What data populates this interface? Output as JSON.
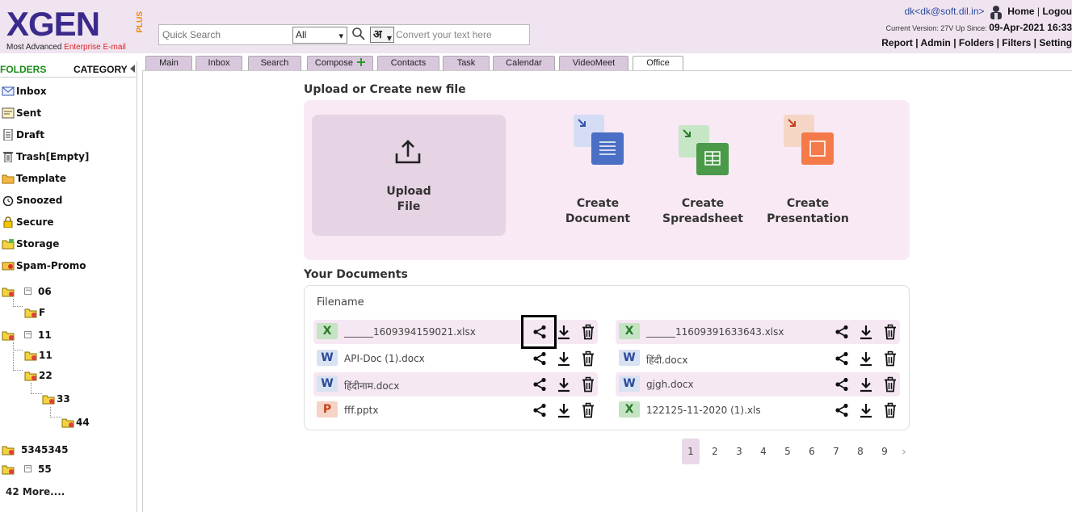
{
  "header": {
    "logo_text": "XGEN",
    "logo_plus": "PLUS",
    "tagline_prefix": "Most Advanced ",
    "tagline_highlight": "Enterprise E-mail",
    "search_placeholder": "Quick Search",
    "search_scope": "All",
    "hindi_button": "अ",
    "convert_placeholder": "Convert your text here",
    "user_email": "dk<dk@soft.dil.in>",
    "home_link": "Home",
    "logout_link": "Logou",
    "version_prefix": "Current Version: 27V Up Since:",
    "version_date": "09-Apr-2021 16:33",
    "top_links": [
      "Report",
      "Admin",
      "Folders",
      "Filters",
      "Setting"
    ]
  },
  "tabs": [
    "Main",
    "Inbox",
    "Search",
    "Compose",
    "Contacts",
    "Task",
    "Calendar",
    "VideoMeet",
    "Office"
  ],
  "active_tab": "Office",
  "sidebar": {
    "folders_label": "FOLDERS",
    "category_label": "CATEGORY",
    "items": [
      {
        "label": "Inbox",
        "icon": "inbox-icon"
      },
      {
        "label": "Sent",
        "icon": "sent-icon"
      },
      {
        "label": "Draft",
        "icon": "draft-icon"
      },
      {
        "label": "Trash[Empty]",
        "icon": "trash-icon"
      },
      {
        "label": "Template",
        "icon": "template-icon"
      },
      {
        "label": "Snoozed",
        "icon": "snoozed-icon"
      },
      {
        "label": "Secure",
        "icon": "lock-icon"
      },
      {
        "label": "Storage",
        "icon": "storage-icon"
      },
      {
        "label": "Spam-Promo",
        "icon": "spam-icon"
      }
    ],
    "tree": [
      "06",
      "F",
      "11",
      "11",
      "22",
      "33",
      "44",
      "5345345",
      "55"
    ],
    "more_label": "42 More...."
  },
  "office": {
    "upload_title": "Upload or Create new file",
    "upload_label_1": "Upload",
    "upload_label_2": "File",
    "create_document_1": "Create",
    "create_document_2": "Document",
    "create_spreadsheet_1": "Create",
    "create_spreadsheet_2": "Spreadsheet",
    "create_presentation_1": "Create",
    "create_presentation_2": "Presentation",
    "docs_title": "Your Documents",
    "filename_header": "Filename",
    "documents": [
      {
        "name": "______1609394159021.xlsx",
        "type": "X"
      },
      {
        "name": "______11609391633643.xlsx",
        "type": "X"
      },
      {
        "name": "API-Doc (1).docx",
        "type": "W"
      },
      {
        "name": "हिंदी.docx",
        "type": "W"
      },
      {
        "name": "हिंदीनाम.docx",
        "type": "W"
      },
      {
        "name": "gjgh.docx",
        "type": "W"
      },
      {
        "name": "fff.pptx",
        "type": "P"
      },
      {
        "name": "122125-11-2020 (1).xls",
        "type": "X"
      }
    ],
    "pages": [
      "1",
      "2",
      "3",
      "4",
      "5",
      "6",
      "7",
      "8",
      "9"
    ],
    "active_page": "1",
    "next_page_glyph": "›"
  },
  "colors": {
    "header_bg": "#f0e4f0",
    "panel_bg": "#f8e9f5",
    "folders_green": "#1a8a1a",
    "logo_purple": "#3a2a8c"
  }
}
